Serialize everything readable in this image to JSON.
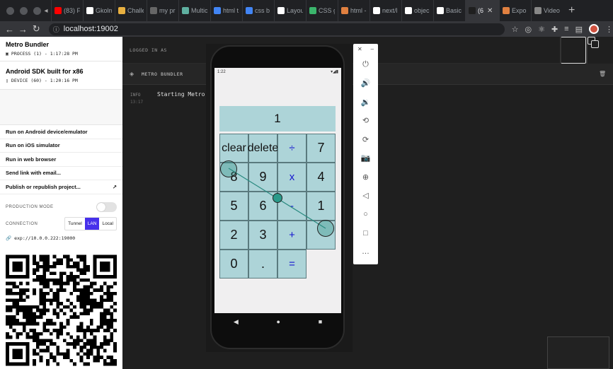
{
  "browser": {
    "tabs": [
      {
        "label": "(83) F",
        "color": "#ff0000"
      },
      {
        "label": "Gkolm",
        "color": "#ffffff"
      },
      {
        "label": "Challe",
        "color": "#e8b040"
      },
      {
        "label": "my pr",
        "color": "#666666"
      },
      {
        "label": "Multic",
        "color": "#5fb0a0"
      },
      {
        "label": "html t",
        "color": "#4285f4"
      },
      {
        "label": "css b",
        "color": "#4285f4"
      },
      {
        "label": "Layou",
        "color": "#ffffff"
      },
      {
        "label": "CSS g",
        "color": "#3bb56c"
      },
      {
        "label": "html -",
        "color": "#e08040"
      },
      {
        "label": "next/l",
        "color": "#ffffff"
      },
      {
        "label": "objec",
        "color": "#ffffff"
      },
      {
        "label": "Basic",
        "color": "#ffffff"
      },
      {
        "label": "(6",
        "color": "#1f1f1f"
      },
      {
        "label": "Expo",
        "color": "#e08040"
      },
      {
        "label": "Video",
        "color": "#888888"
      }
    ],
    "url": "localhost:19002"
  },
  "left_panel": {
    "devices": [
      {
        "name": "Metro Bundler",
        "sub": "PROCESS (1) - 1:17:28 PM"
      },
      {
        "name": "Android SDK built for x86",
        "sub": "DEVICE (60) - 1:20:16 PM"
      }
    ],
    "menu": [
      "Run on Android device/emulator",
      "Run on iOS simulator",
      "Run in web browser",
      "Send link with email...",
      "Publish or republish project..."
    ],
    "production_mode_label": "PRODUCTION MODE",
    "production_mode": false,
    "connection_label": "CONNECTION",
    "connection_options": [
      "Tunnel",
      "LAN",
      "Local"
    ],
    "connection_selected": "LAN",
    "exp_url": "exp://10.0.0.222:19000"
  },
  "main": {
    "logged_in": "LOGGED IN AS",
    "bundler_title": "METRO BUNDLER",
    "log_level": "INFO",
    "log_time": "13:17",
    "log_message": "Starting Metro"
  },
  "emulator": {
    "status_time": "1:22",
    "display_value": "1",
    "keys": [
      "clear",
      "delete",
      "÷",
      "7",
      "8",
      "9",
      "x",
      "4",
      "5",
      "6",
      "-",
      "1",
      "2",
      "3",
      "+",
      "",
      "0",
      ".",
      "="
    ]
  },
  "colors": {
    "accent": "#4630eb",
    "calc_key": "#add4d8",
    "operator": "#1515d0"
  }
}
